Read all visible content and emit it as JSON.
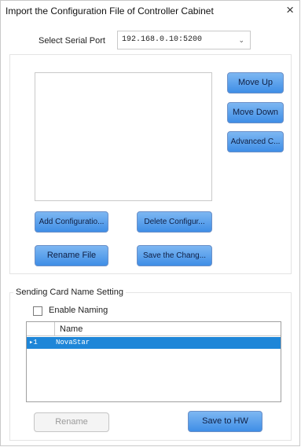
{
  "window": {
    "title": "Import the Configuration File of Controller Cabinet",
    "close_glyph": "×"
  },
  "serial_port": {
    "label": "Select Serial Port",
    "value": "192.168.0.10:5200"
  },
  "config_buttons": {
    "move_up": "Move Up",
    "move_down": "Move Down",
    "advanced": "Advanced C...",
    "add": "Add Configuratio...",
    "delete": "Delete Configur...",
    "rename": "Rename File",
    "save": "Save the Chang..."
  },
  "naming": {
    "group_title": "Sending Card Name Setting",
    "enable_label": "Enable Naming",
    "enable_checked": false,
    "table": {
      "header": "Name",
      "rows": [
        {
          "index": "1",
          "name": "NovaStar"
        }
      ]
    },
    "rename_button": "Rename",
    "save_button": "Save to HW"
  },
  "colors": {
    "button_fill": "#4f9be8",
    "selected_row": "#1e86d8"
  },
  "icons": {
    "close": "close-icon",
    "dropdown": "chevron-down-icon",
    "row_pointer": "row-pointer-icon"
  }
}
